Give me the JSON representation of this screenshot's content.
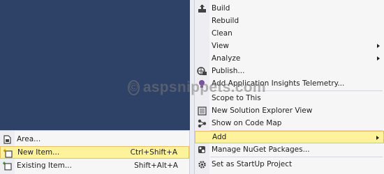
{
  "main_menu": {
    "items": [
      {
        "label": "Build",
        "icon": "build-icon"
      },
      {
        "label": "Rebuild",
        "icon": ""
      },
      {
        "label": "Clean",
        "icon": ""
      },
      {
        "label": "View",
        "icon": "",
        "submenu": true
      },
      {
        "label": "Analyze",
        "icon": "",
        "submenu": true
      },
      {
        "label": "Publish...",
        "icon": "publish-icon"
      },
      {
        "label": "Add Application Insights Telemetry...",
        "icon": "insights-icon"
      },
      {
        "label": "Scope to This",
        "icon": ""
      },
      {
        "label": "New Solution Explorer View",
        "icon": "solution-explorer-icon"
      },
      {
        "label": "Show on Code Map",
        "icon": "code-map-icon"
      },
      {
        "label": "Add",
        "icon": "",
        "submenu": true
      },
      {
        "label": "Manage NuGet Packages...",
        "icon": "nuget-icon"
      },
      {
        "label": "Set as StartUp Project",
        "icon": "gear-icon"
      }
    ]
  },
  "add_submenu": {
    "items": [
      {
        "label": "Area...",
        "icon": "area-icon",
        "shortcut": ""
      },
      {
        "label": "New Item...",
        "icon": "new-item-icon",
        "shortcut": "Ctrl+Shift+A"
      },
      {
        "label": "Existing Item...",
        "icon": "existing-item-icon",
        "shortcut": "Shift+Alt+A"
      }
    ]
  },
  "watermark": {
    "symbol": "©",
    "text": "aspsnippets.com"
  },
  "colors": {
    "background_dark": "#2e4166",
    "menu_background": "#f6f6f6",
    "highlight": "#fff29d",
    "highlight_border": "#e5c365"
  }
}
